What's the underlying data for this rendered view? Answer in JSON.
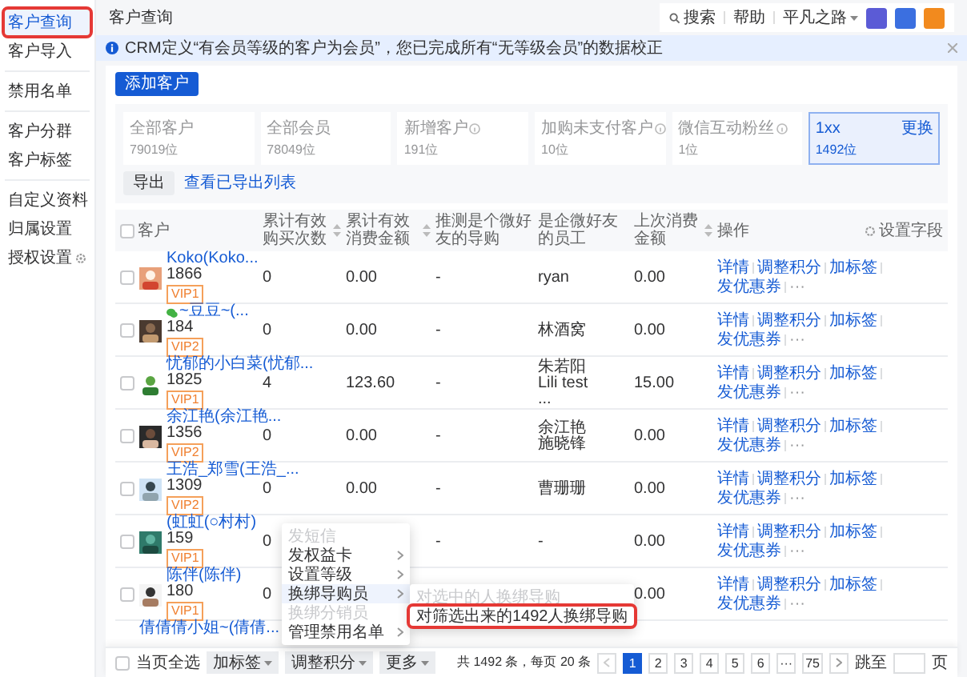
{
  "sidebar": {
    "groups": [
      {
        "items": [
          {
            "label": "客户查询",
            "gear": false,
            "selected": true,
            "annotated": true
          },
          {
            "label": "客户导入",
            "gear": false,
            "selected": false,
            "annotated": false
          }
        ]
      },
      {
        "items": [
          {
            "label": "禁用名单",
            "gear": false,
            "selected": false,
            "annotated": false
          }
        ]
      },
      {
        "items": [
          {
            "label": "客户分群",
            "gear": false,
            "selected": false,
            "annotated": false
          },
          {
            "label": "客户标签",
            "gear": false,
            "selected": false,
            "annotated": false
          }
        ]
      },
      {
        "items": [
          {
            "label": "自定义资料",
            "gear": false,
            "selected": false,
            "annotated": false
          },
          {
            "label": "归属设置",
            "gear": false,
            "selected": false,
            "annotated": false
          },
          {
            "label": "授权设置",
            "gear": true,
            "selected": false,
            "annotated": false
          }
        ]
      }
    ]
  },
  "page_title": "客户查询",
  "top_bar": {
    "search": "搜索",
    "help": "帮助",
    "account": "平凡之路",
    "apps": [
      {
        "color": "#5b5bd6"
      },
      {
        "color": "#3b6fe0"
      },
      {
        "color": "#f28a1e"
      }
    ]
  },
  "notice": {
    "text": "CRM定义“有会员等级的客户为会员”，您已完成所有“无等级会员”的数据校正"
  },
  "add_button": "添加客户",
  "stat_cards": [
    {
      "label": "全部客户",
      "value": "79019位",
      "info": false,
      "selected": false
    },
    {
      "label": "全部会员",
      "value": "78049位",
      "info": false,
      "selected": false
    },
    {
      "label": "新增客户",
      "value": "191位",
      "info": true,
      "selected": false
    },
    {
      "label": "加购未支付客户",
      "value": "10位",
      "info": true,
      "selected": false
    },
    {
      "label": "微信互动粉丝",
      "value": "1位",
      "info": true,
      "selected": false
    },
    {
      "label": "1xx",
      "value": "1492位",
      "action": "更换",
      "info": false,
      "selected": true
    }
  ],
  "export_button": "导出",
  "export_list_link": "查看已导出列表",
  "table": {
    "columns": [
      {
        "label": "客户",
        "sortable": false
      },
      {
        "label": "累计有效购买次数",
        "sortable": true
      },
      {
        "label": "累计有效消费金额",
        "sortable": true
      },
      {
        "label": "推测是个微好友的导购",
        "sortable": false
      },
      {
        "label": "是企微好友的员工",
        "sortable": false
      },
      {
        "label": "上次消费金额",
        "sortable": true
      },
      {
        "label": "操作",
        "sortable": false
      }
    ],
    "settings": "设置字段",
    "select_all_checked": false,
    "rows": [
      {
        "name": "Koko(Koko...",
        "checked": false,
        "wechat": false,
        "phone": "1866",
        "vip": "VIP1",
        "purchases": "0",
        "amount": "0.00",
        "guide": "-",
        "staff": [
          "ryan"
        ],
        "last_amount": "0.00",
        "actions": [
          "详情",
          "调整积分",
          "加标签",
          "发优惠券",
          "···"
        ]
      },
      {
        "name": "~豆豆~(...",
        "checked": false,
        "wechat": true,
        "phone": "184",
        "vip": "VIP2",
        "purchases": "0",
        "amount": "0.00",
        "guide": "-",
        "staff": [
          "林酒窝"
        ],
        "last_amount": "0.00",
        "actions": [
          "详情",
          "调整积分",
          "加标签",
          "发优惠券",
          "···"
        ]
      },
      {
        "name": "忧郁的小白菜(忧郁...",
        "checked": false,
        "wechat": false,
        "phone": "1825",
        "vip": "VIP1",
        "purchases": "4",
        "amount": "123.60",
        "guide": "-",
        "staff": [
          "朱若阳",
          "Lili test",
          "..."
        ],
        "last_amount": "15.00",
        "actions": [
          "详情",
          "调整积分",
          "加标签",
          "发优惠券",
          "···"
        ]
      },
      {
        "name": "余江艳(余江艳...",
        "checked": false,
        "wechat": false,
        "phone": "1356",
        "vip": "VIP2",
        "purchases": "0",
        "amount": "0.00",
        "guide": "-",
        "staff": [
          "余江艳",
          "施晓锋"
        ],
        "last_amount": "0.00",
        "actions": [
          "详情",
          "调整积分",
          "加标签",
          "发优惠券",
          "···"
        ]
      },
      {
        "name": "王浩_郑雪(王浩_...",
        "checked": false,
        "wechat": false,
        "phone": "1309",
        "vip": "VIP2",
        "purchases": "0",
        "amount": "0.00",
        "guide": "-",
        "staff": [
          "曹珊珊"
        ],
        "last_amount": "0.00",
        "actions": [
          "详情",
          "调整积分",
          "加标签",
          "发优惠券",
          "···"
        ]
      },
      {
        "name": "(虹虹(○村村)",
        "checked": false,
        "wechat": false,
        "phone": "159",
        "vip": "VIP1",
        "purchases": "0",
        "guide": "-",
        "staff": [
          "-"
        ],
        "last_amount": "0.00",
        "actions": [
          "详情",
          "调整积分",
          "加标签",
          "发优惠券",
          "···"
        ]
      },
      {
        "name": "陈伴(陈伴)",
        "checked": false,
        "wechat": false,
        "phone": "180",
        "vip": "VIP1",
        "purchases": "0",
        "last_amount": "0.00",
        "actions": [
          "详情",
          "调整积分",
          "加标签",
          "发优惠券",
          "···"
        ]
      },
      {
        "name": "倩倩倩小姐~(倩倩..."
      }
    ]
  },
  "context_menu": {
    "items": [
      {
        "label": "发短信",
        "disabled": true,
        "submenu": false,
        "selected": false
      },
      {
        "label": "发权益卡",
        "disabled": false,
        "submenu": true,
        "selected": false
      },
      {
        "label": "设置等级",
        "disabled": false,
        "submenu": true,
        "selected": false
      },
      {
        "label": "换绑导购员",
        "disabled": false,
        "submenu": true,
        "selected": true
      },
      {
        "label": "换绑分销员",
        "disabled": true,
        "submenu": false,
        "selected": false
      },
      {
        "label": "管理禁用名单",
        "disabled": false,
        "submenu": true,
        "selected": false
      }
    ],
    "submenu": [
      {
        "label": "对选中的人换绑导购",
        "disabled": true,
        "annotated": false
      },
      {
        "label": "对筛选出来的1492人换绑导购",
        "disabled": false,
        "annotated": true
      }
    ]
  },
  "bottom_bar": {
    "select_all": "当页全选",
    "select_all_checked": false,
    "actions": [
      "加标签",
      "调整积分",
      "更多"
    ],
    "total": "共 1492 条，每页 20 条",
    "pages": [
      {
        "label": "1",
        "selected": true
      },
      {
        "label": "2",
        "selected": false
      },
      {
        "label": "3",
        "selected": false
      },
      {
        "label": "4",
        "selected": false
      },
      {
        "label": "5",
        "selected": false
      },
      {
        "label": "6",
        "selected": false
      },
      {
        "label": "···",
        "selected": false
      },
      {
        "label": "75",
        "selected": false
      }
    ],
    "jump_label": "跳至",
    "page_suffix": "页"
  }
}
